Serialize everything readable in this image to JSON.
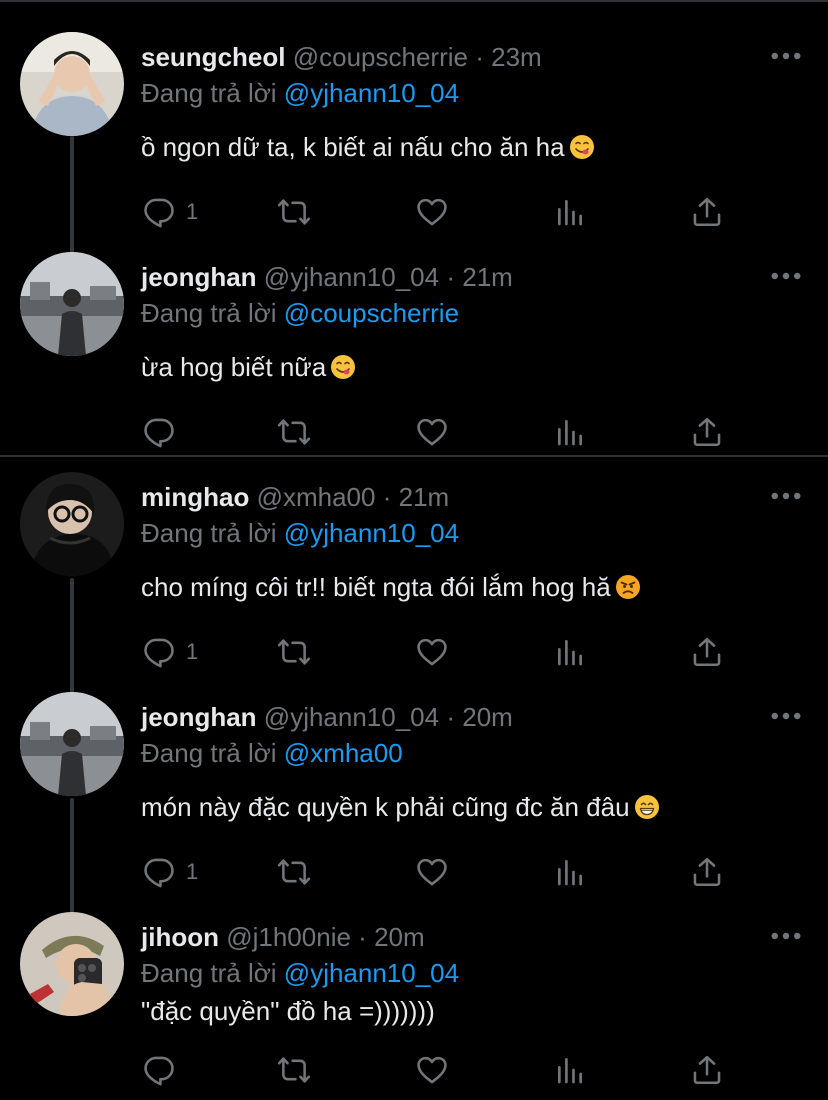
{
  "colors": {
    "background": "#000000",
    "text": "#e7e9ea",
    "muted": "#71767b",
    "link": "#1d9bf0",
    "divider": "#2f3336"
  },
  "icons": {
    "more": "more-icon",
    "reply": "reply-icon",
    "retweet": "retweet-icon",
    "like": "like-icon",
    "views": "views-icon",
    "share": "share-icon"
  },
  "tweets": [
    {
      "name": "seungcheol",
      "handle": "@coupscherrie",
      "time": "23m",
      "reply_prefix": "Đang trả lời",
      "reply_to": "@yjhann10_04",
      "text": "ồ ngon dữ ta, k biết ai nấu cho ăn ha",
      "emoji": "yum-emoji",
      "reply_count": "1"
    },
    {
      "name": "jeonghan",
      "handle": "@yjhann10_04",
      "time": "21m",
      "reply_prefix": "Đang trả lời",
      "reply_to": "@coupscherrie",
      "text": "ừa hog biết nữa",
      "emoji": "yum-emoji",
      "reply_count": ""
    },
    {
      "name": "minghao",
      "handle": "@xmha00",
      "time": "21m",
      "reply_prefix": "Đang trả lời",
      "reply_to": "@yjhann10_04",
      "text": "cho míng côi tr!! biết ngta đói lắm hog hă",
      "emoji": "angry-emoji",
      "reply_count": "1"
    },
    {
      "name": "jeonghan",
      "handle": "@yjhann10_04",
      "time": "20m",
      "reply_prefix": "Đang trả lời",
      "reply_to": "@xmha00",
      "text": "món này đặc quyền k phải cũng đc ăn đâu",
      "emoji": "grin-emoji",
      "reply_count": "1"
    },
    {
      "name": "jihoon",
      "handle": "@j1h00nie",
      "time": "20m",
      "reply_prefix": "Đang trả lời",
      "reply_to": "@yjhann10_04",
      "text": "\"đặc quyền\" đồ ha =)))))))",
      "emoji": "",
      "reply_count": ""
    }
  ]
}
